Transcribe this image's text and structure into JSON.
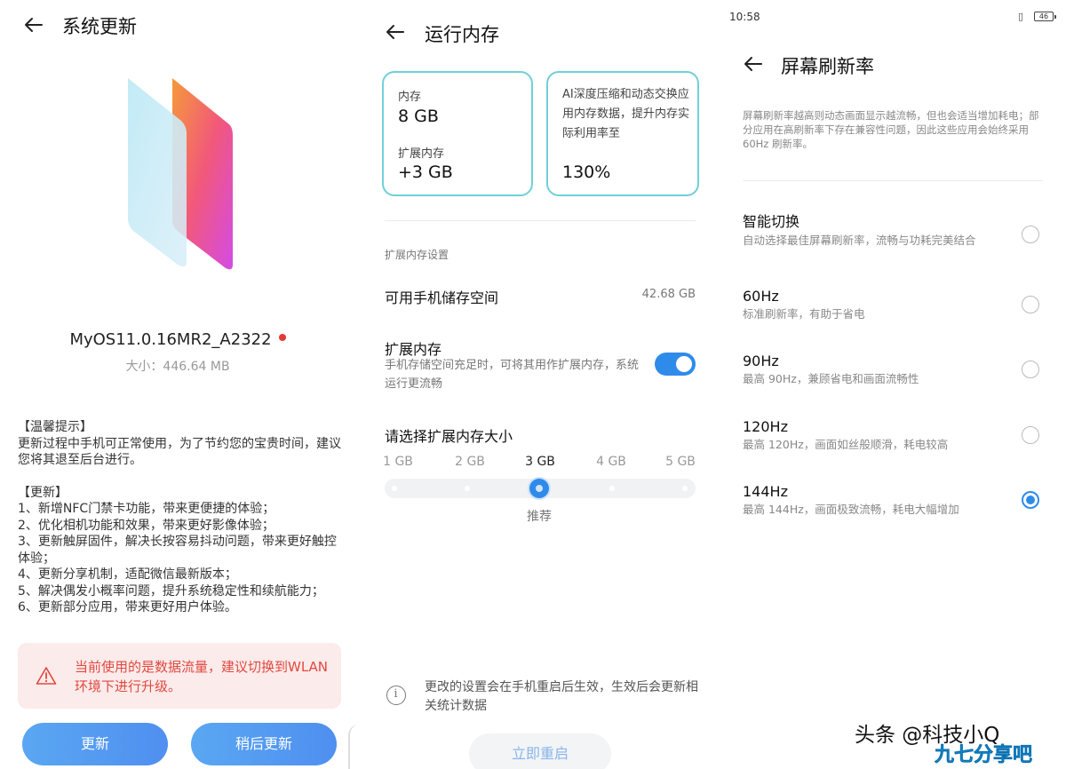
{
  "panel1": {
    "title": "系统更新",
    "version": "MyOS11.0.16MR2_A2322",
    "size": "大小：446.64 MB",
    "notes": [
      {
        "heading": "【温馨提示】",
        "lines": [
          "更新过程中手机可正常使用，为了节约您的宝贵时间，建议您将其退至后台进行。"
        ]
      },
      {
        "heading": "【更新】",
        "lines": [
          "1、新增NFC门禁卡功能，带来更便捷的体验；",
          "2、优化相机功能和效果，带来更好影像体验；",
          "3、更新触屏固件，解决长按容易抖动问题，带来更好触控体验；",
          "4、更新分享机制，适配微信最新版本；",
          "5、解决偶发小概率问题，提升系统稳定性和续航能力；",
          "6、更新部分应用，带来更好用户体验。"
        ]
      }
    ],
    "warning": "当前使用的是数据流量，建议切换到WLAN环境下进行升级。",
    "update_button": "更新",
    "later_button": "稍后更新"
  },
  "panel2": {
    "title": "运行内存",
    "card_memory": {
      "mem_label": "内存",
      "mem_value": "8 GB",
      "ext_label": "扩展内存",
      "ext_value": "+3 GB"
    },
    "card_ai": {
      "desc": "AI深度压缩和动态交换应用内存数据，提升内存实际利用率至",
      "value": "130%"
    },
    "section_label": "扩展内存设置",
    "storage_label": "可用手机储存空间",
    "storage_value": "42.68 GB",
    "ext_title": "扩展内存",
    "ext_desc": "手机存储空间充足时，可将其用作扩展内存，系统运行更流畅",
    "ext_enabled": true,
    "select_title": "请选择扩展内存大小",
    "size_options": [
      "1 GB",
      "2 GB",
      "3 GB",
      "4 GB",
      "5 GB"
    ],
    "selected_option": "3 GB",
    "recommended": "推荐",
    "info": "更改的设置会在手机重启后生效，生效后会更新相关统计数据",
    "restart_button": "立即重启"
  },
  "panel3": {
    "status_time": "10:58",
    "battery": "46",
    "title": "屏幕刷新率",
    "hint": "屏幕刷新率越高则动态画面显示越流畅，但也会适当增加耗电；部分应用在高刷新率下存在兼容性问题，因此这些应用会始终采用 60Hz 刷新率。",
    "options": [
      {
        "title": "智能切换",
        "desc": "自动选择最佳屏幕刷新率，流畅与功耗完美结合",
        "selected": false
      },
      {
        "title": "60Hz",
        "desc": "标准刷新率，有助于省电",
        "selected": false
      },
      {
        "title": "90Hz",
        "desc": "最高 90Hz，兼顾省电和画面流畅性",
        "selected": false
      },
      {
        "title": "120Hz",
        "desc": "最高 120Hz，画面如丝般顺滑，耗电较高",
        "selected": false
      },
      {
        "title": "144Hz",
        "desc": "最高 144Hz，画面极致流畅，耗电大幅增加",
        "selected": true
      }
    ]
  },
  "watermark": {
    "line1": "头条 @科技小Q",
    "line2": "九七分享吧"
  },
  "colors": {
    "accent": "#2f8be9",
    "card_border": "#6fd0d8",
    "warning_text": "#e0493f",
    "warning_bg": "#fcebeb"
  }
}
